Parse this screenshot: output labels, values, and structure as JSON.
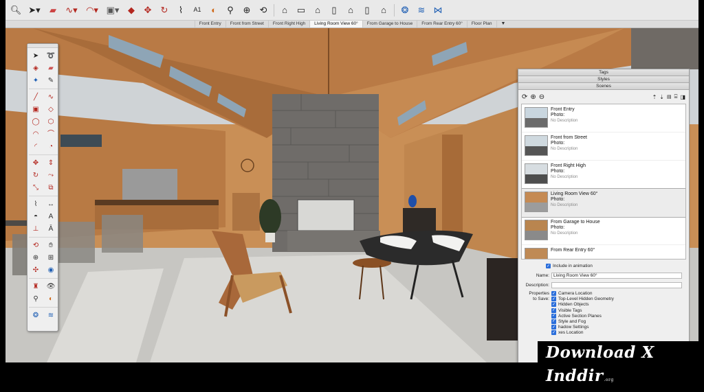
{
  "toolbar": {
    "icons": [
      "search-icon",
      "select-arrow-icon",
      "eraser-icon",
      "freehand-icon",
      "arc-icon",
      "rectangle-icon",
      "paint-bucket-icon",
      "move-icon",
      "rotate-icon",
      "tape-measure-icon",
      "text-icon",
      "section-plane-icon",
      "walk-icon",
      "zoom-icon",
      "orbit-icon",
      "iso-view-icon",
      "top-view-icon",
      "front-view-icon",
      "right-view-icon",
      "back-view-icon",
      "left-view-icon",
      "extension-warehouse-icon",
      "sandbox-icon",
      "sandbox-smoove-icon"
    ]
  },
  "scene_tabs": {
    "tabs": [
      "Front Entry",
      "Front from Street",
      "Front Right High",
      "Living Room View 60°",
      "From Garage to House",
      "From Rear Entry 60°",
      "Floor Plan"
    ],
    "active_index": 3,
    "more_label": "▼"
  },
  "tray": {
    "panels": {
      "tags": "Tags",
      "styles": "Styles",
      "scenes": "Scenes"
    },
    "tool_icons": [
      "refresh-icon",
      "add-scene-icon",
      "remove-scene-icon",
      "move-up-icon",
      "move-down-icon",
      "view-options-icon",
      "details-icon",
      "expand-icon"
    ],
    "scenes": [
      {
        "name": "Front Entry",
        "photo_label": "Photo:",
        "description": "No Description",
        "sky": "#c9d6df",
        "ground": "#6b6b6b"
      },
      {
        "name": "Front from Street",
        "photo_label": "Photo:",
        "description": "No Description",
        "sky": "#cfd9df",
        "ground": "#555555"
      },
      {
        "name": "Front Right High",
        "photo_label": "Photo:",
        "description": "No Description",
        "sky": "#d7dde1",
        "ground": "#4e4e4e"
      },
      {
        "name": "Living Room View 60°",
        "photo_label": "Photo:",
        "description": "No Description",
        "sky": "#c58a53",
        "ground": "#9c9c9c"
      },
      {
        "name": "From Garage to House",
        "photo_label": "Photo:",
        "description": "No Description",
        "sky": "#b9854f",
        "ground": "#8a8a8a"
      },
      {
        "name": "From Rear Entry 60°",
        "photo_label": "Photo:",
        "description": "No Description",
        "sky": "#bf8a55",
        "ground": "#7d7d7d"
      }
    ],
    "selected_index": 3,
    "include_in_animation": "Include in animation",
    "name_label": "Name:",
    "name_value": "Living Room View 60°",
    "description_label": "Description:",
    "description_value": "",
    "properties_label_line1": "Properties",
    "properties_label_line2": "to Save:",
    "properties": [
      "Camera Location",
      "Top-Level Hidden Geometry",
      "Hidden Objects",
      "Visible Tags",
      "Active Section Planes",
      "Style and Fog",
      "hadow Settings",
      "xes Location"
    ]
  },
  "palette": {
    "icons": [
      "select-icon",
      "lasso-icon",
      "paint-icon",
      "eraser-icon",
      "move-tag-icon",
      "pencil-icon",
      "line-icon",
      "freehand-icon",
      "rectangle-icon",
      "rotated-rectangle-icon",
      "circle-icon",
      "polygon-icon",
      "arc-icon",
      "two-point-arc-icon",
      "three-point-arc-icon",
      "pie-icon",
      "move-icon",
      "push-pull-icon",
      "rotate-icon",
      "follow-me-icon",
      "scale-icon",
      "offset-icon",
      "tape-measure-icon",
      "dimension-icon",
      "protractor-icon",
      "text-icon",
      "axes-icon",
      "3d-text-icon",
      "orbit-icon",
      "pan-icon",
      "zoom-icon",
      "zoom-window-icon",
      "zoom-extents-icon",
      "previous-icon",
      "position-camera-icon",
      "look-around-icon",
      "walk-icon",
      "section-plane-icon",
      "footprints-icon",
      "warehouse-icon",
      "extension-icon",
      "sandbox-icon"
    ]
  },
  "watermark": {
    "text": "Download X Inddir",
    "suffix": ".org"
  },
  "colors": {
    "wood": "#b97a45",
    "wood_dark": "#8d5a30",
    "stone": "#6f6c69",
    "floor": "#c9c9c6",
    "accent_blue": "#2a6edb"
  }
}
